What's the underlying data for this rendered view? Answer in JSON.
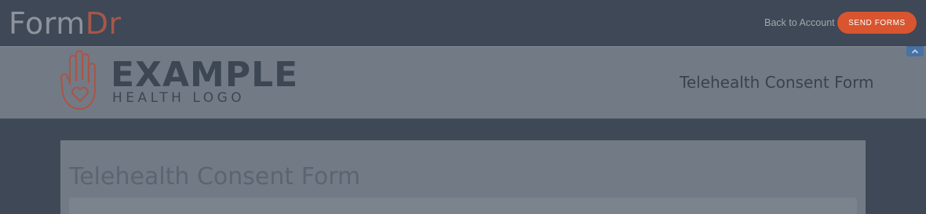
{
  "topbar": {
    "brand_part1": "Form",
    "brand_part2": "Dr",
    "back_link": "Back to Account",
    "send_button": "SEND FORMS"
  },
  "header": {
    "logo_line1": "EXAMPLE",
    "logo_line2": "HEALTH LOGO",
    "title": "Telehealth Consent Form",
    "collapse_icon": "chevron-up-icon"
  },
  "form": {
    "title": "Telehealth Consent Form"
  },
  "colors": {
    "topbar_bg": "#3e4856",
    "accent": "#d8552f",
    "brand_accent": "#a8564a",
    "header_bg": "#727b85",
    "collapse_tab": "#4672a4"
  }
}
